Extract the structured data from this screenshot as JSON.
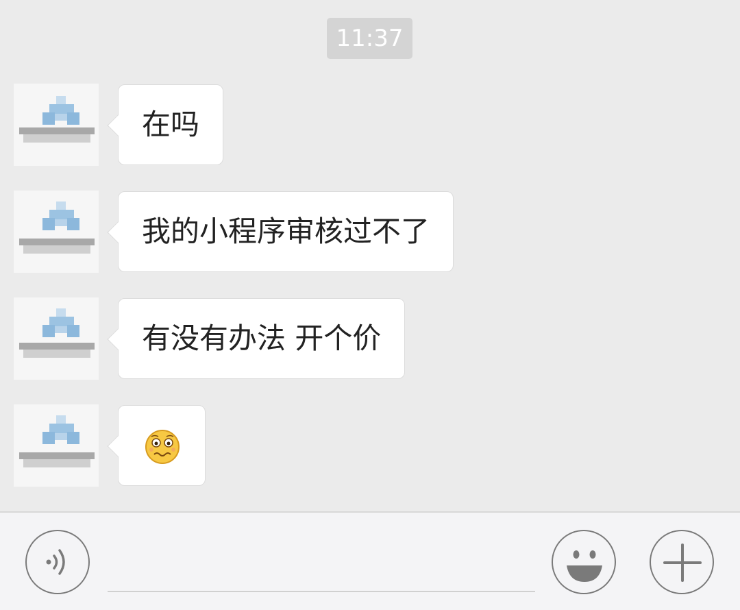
{
  "chat": {
    "timestamp": "11:37",
    "messages": [
      {
        "sender": "contact",
        "type": "text",
        "text": "在吗"
      },
      {
        "sender": "contact",
        "type": "text",
        "text": "我的小程序审核过不了"
      },
      {
        "sender": "contact",
        "type": "text",
        "text": "有没有办法 开个价"
      },
      {
        "sender": "contact",
        "type": "emoji",
        "emoji": "worried-face-emoji"
      }
    ]
  },
  "input_bar": {
    "voice_icon": "voice-icon",
    "emoji_icon": "smiley-icon",
    "plus_icon": "plus-icon",
    "text_value": ""
  },
  "colors": {
    "chat_background": "#ebebeb",
    "bubble_background": "#ffffff",
    "timestamp_background": "#d4d4d4",
    "input_bar_background": "#f4f4f6",
    "icon_stroke": "#7a7a7a",
    "avatar_blue": "#8cb8dc"
  }
}
